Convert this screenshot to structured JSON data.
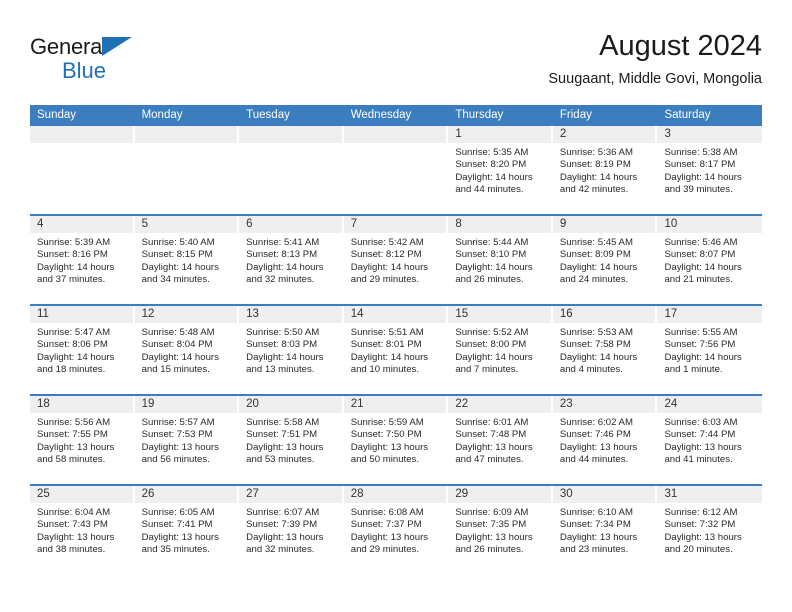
{
  "brand": {
    "name_part1": "General",
    "name_part2": "Blue",
    "triangle_icon": "brand-triangle-icon",
    "accent_color": "#1f70b5"
  },
  "header": {
    "title": "August 2024",
    "subtitle": "Suugaant, Middle Govi, Mongolia"
  },
  "calendar": {
    "header_bg": "#3b7dbf",
    "daynum_bg": "#efefef",
    "weekday_headers": [
      "Sunday",
      "Monday",
      "Tuesday",
      "Wednesday",
      "Thursday",
      "Friday",
      "Saturday"
    ],
    "weeks": [
      [
        {
          "day": "",
          "lines": []
        },
        {
          "day": "",
          "lines": []
        },
        {
          "day": "",
          "lines": []
        },
        {
          "day": "",
          "lines": []
        },
        {
          "day": "1",
          "lines": [
            "Sunrise: 5:35 AM",
            "Sunset: 8:20 PM",
            "Daylight: 14 hours",
            "and 44 minutes."
          ]
        },
        {
          "day": "2",
          "lines": [
            "Sunrise: 5:36 AM",
            "Sunset: 8:19 PM",
            "Daylight: 14 hours",
            "and 42 minutes."
          ]
        },
        {
          "day": "3",
          "lines": [
            "Sunrise: 5:38 AM",
            "Sunset: 8:17 PM",
            "Daylight: 14 hours",
            "and 39 minutes."
          ]
        }
      ],
      [
        {
          "day": "4",
          "lines": [
            "Sunrise: 5:39 AM",
            "Sunset: 8:16 PM",
            "Daylight: 14 hours",
            "and 37 minutes."
          ]
        },
        {
          "day": "5",
          "lines": [
            "Sunrise: 5:40 AM",
            "Sunset: 8:15 PM",
            "Daylight: 14 hours",
            "and 34 minutes."
          ]
        },
        {
          "day": "6",
          "lines": [
            "Sunrise: 5:41 AM",
            "Sunset: 8:13 PM",
            "Daylight: 14 hours",
            "and 32 minutes."
          ]
        },
        {
          "day": "7",
          "lines": [
            "Sunrise: 5:42 AM",
            "Sunset: 8:12 PM",
            "Daylight: 14 hours",
            "and 29 minutes."
          ]
        },
        {
          "day": "8",
          "lines": [
            "Sunrise: 5:44 AM",
            "Sunset: 8:10 PM",
            "Daylight: 14 hours",
            "and 26 minutes."
          ]
        },
        {
          "day": "9",
          "lines": [
            "Sunrise: 5:45 AM",
            "Sunset: 8:09 PM",
            "Daylight: 14 hours",
            "and 24 minutes."
          ]
        },
        {
          "day": "10",
          "lines": [
            "Sunrise: 5:46 AM",
            "Sunset: 8:07 PM",
            "Daylight: 14 hours",
            "and 21 minutes."
          ]
        }
      ],
      [
        {
          "day": "11",
          "lines": [
            "Sunrise: 5:47 AM",
            "Sunset: 8:06 PM",
            "Daylight: 14 hours",
            "and 18 minutes."
          ]
        },
        {
          "day": "12",
          "lines": [
            "Sunrise: 5:48 AM",
            "Sunset: 8:04 PM",
            "Daylight: 14 hours",
            "and 15 minutes."
          ]
        },
        {
          "day": "13",
          "lines": [
            "Sunrise: 5:50 AM",
            "Sunset: 8:03 PM",
            "Daylight: 14 hours",
            "and 13 minutes."
          ]
        },
        {
          "day": "14",
          "lines": [
            "Sunrise: 5:51 AM",
            "Sunset: 8:01 PM",
            "Daylight: 14 hours",
            "and 10 minutes."
          ]
        },
        {
          "day": "15",
          "lines": [
            "Sunrise: 5:52 AM",
            "Sunset: 8:00 PM",
            "Daylight: 14 hours",
            "and 7 minutes."
          ]
        },
        {
          "day": "16",
          "lines": [
            "Sunrise: 5:53 AM",
            "Sunset: 7:58 PM",
            "Daylight: 14 hours",
            "and 4 minutes."
          ]
        },
        {
          "day": "17",
          "lines": [
            "Sunrise: 5:55 AM",
            "Sunset: 7:56 PM",
            "Daylight: 14 hours",
            "and 1 minute."
          ]
        }
      ],
      [
        {
          "day": "18",
          "lines": [
            "Sunrise: 5:56 AM",
            "Sunset: 7:55 PM",
            "Daylight: 13 hours",
            "and 58 minutes."
          ]
        },
        {
          "day": "19",
          "lines": [
            "Sunrise: 5:57 AM",
            "Sunset: 7:53 PM",
            "Daylight: 13 hours",
            "and 56 minutes."
          ]
        },
        {
          "day": "20",
          "lines": [
            "Sunrise: 5:58 AM",
            "Sunset: 7:51 PM",
            "Daylight: 13 hours",
            "and 53 minutes."
          ]
        },
        {
          "day": "21",
          "lines": [
            "Sunrise: 5:59 AM",
            "Sunset: 7:50 PM",
            "Daylight: 13 hours",
            "and 50 minutes."
          ]
        },
        {
          "day": "22",
          "lines": [
            "Sunrise: 6:01 AM",
            "Sunset: 7:48 PM",
            "Daylight: 13 hours",
            "and 47 minutes."
          ]
        },
        {
          "day": "23",
          "lines": [
            "Sunrise: 6:02 AM",
            "Sunset: 7:46 PM",
            "Daylight: 13 hours",
            "and 44 minutes."
          ]
        },
        {
          "day": "24",
          "lines": [
            "Sunrise: 6:03 AM",
            "Sunset: 7:44 PM",
            "Daylight: 13 hours",
            "and 41 minutes."
          ]
        }
      ],
      [
        {
          "day": "25",
          "lines": [
            "Sunrise: 6:04 AM",
            "Sunset: 7:43 PM",
            "Daylight: 13 hours",
            "and 38 minutes."
          ]
        },
        {
          "day": "26",
          "lines": [
            "Sunrise: 6:05 AM",
            "Sunset: 7:41 PM",
            "Daylight: 13 hours",
            "and 35 minutes."
          ]
        },
        {
          "day": "27",
          "lines": [
            "Sunrise: 6:07 AM",
            "Sunset: 7:39 PM",
            "Daylight: 13 hours",
            "and 32 minutes."
          ]
        },
        {
          "day": "28",
          "lines": [
            "Sunrise: 6:08 AM",
            "Sunset: 7:37 PM",
            "Daylight: 13 hours",
            "and 29 minutes."
          ]
        },
        {
          "day": "29",
          "lines": [
            "Sunrise: 6:09 AM",
            "Sunset: 7:35 PM",
            "Daylight: 13 hours",
            "and 26 minutes."
          ]
        },
        {
          "day": "30",
          "lines": [
            "Sunrise: 6:10 AM",
            "Sunset: 7:34 PM",
            "Daylight: 13 hours",
            "and 23 minutes."
          ]
        },
        {
          "day": "31",
          "lines": [
            "Sunrise: 6:12 AM",
            "Sunset: 7:32 PM",
            "Daylight: 13 hours",
            "and 20 minutes."
          ]
        }
      ]
    ]
  }
}
